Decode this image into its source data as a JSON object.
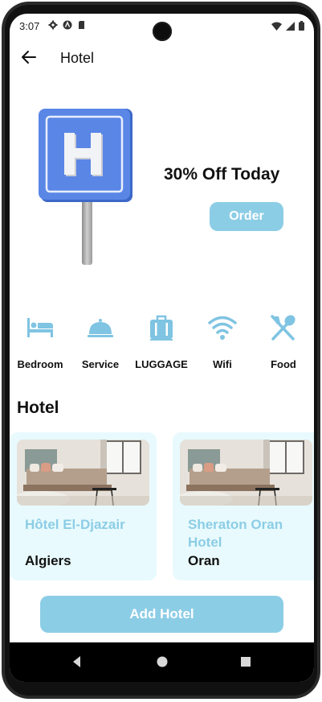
{
  "status": {
    "time": "3:07"
  },
  "appbar": {
    "title": "Hotel"
  },
  "promo": {
    "text": "30% Off Today",
    "order_label": "Order",
    "sign_letter": "H"
  },
  "amenities": [
    {
      "label": "Bedroom",
      "icon": "bed-icon"
    },
    {
      "label": "Service",
      "icon": "cloche-icon"
    },
    {
      "label": "LUGGAGE",
      "icon": "luggage-icon"
    },
    {
      "label": "Wifi",
      "icon": "wifi-icon"
    },
    {
      "label": "Food",
      "icon": "utensils-icon"
    }
  ],
  "section": {
    "title": "Hotel"
  },
  "hotels": [
    {
      "name": "Hôtel El-Djazair",
      "city": "Algiers"
    },
    {
      "name": "Sheraton Oran Hotel",
      "city": "Oran"
    }
  ],
  "add_label": "Add Hotel",
  "colors": {
    "accent": "#8ccde6",
    "card_bg": "#e8fafd",
    "sign_blue": "#4f7fe0"
  }
}
